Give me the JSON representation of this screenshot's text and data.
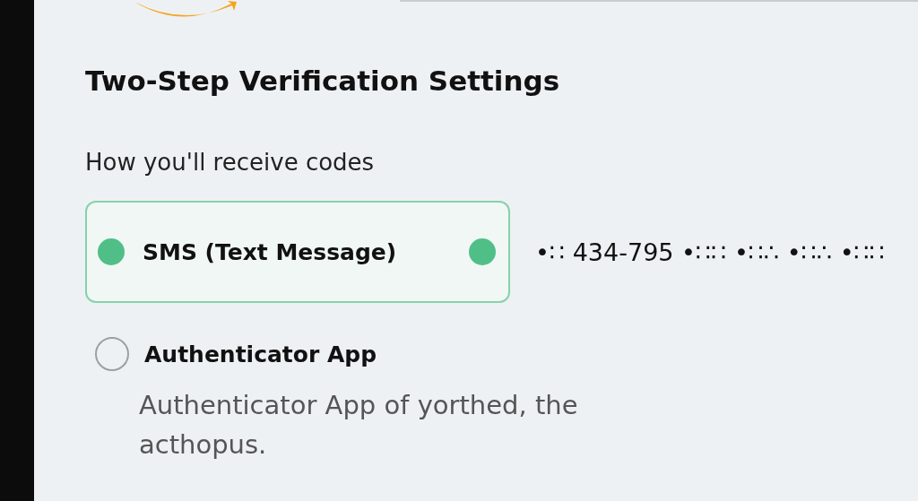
{
  "title": "Two-Step Verification Settings",
  "subtitle": "How you'll receive codes",
  "options": [
    {
      "label": "SMS (Text Message)",
      "selected": true,
      "verified": true,
      "phone": "•∷ 434-795 •∷∷ •∷∴ •∷∴ •∷∷"
    },
    {
      "label": "Authenticator App",
      "selected": false,
      "verified": false,
      "description": "Authenticator App of yorthed, the acthopus."
    }
  ]
}
